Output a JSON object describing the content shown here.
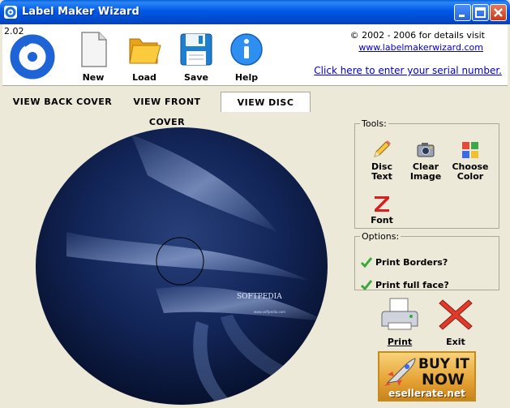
{
  "window": {
    "title": "Label Maker Wizard"
  },
  "header": {
    "version": "2.02",
    "tools": [
      {
        "label": "New"
      },
      {
        "label": "Load"
      },
      {
        "label": "Save"
      },
      {
        "label": "Help"
      }
    ],
    "copyright": "© 2002 - 2006 for details visit",
    "website": "www.labelmakerwizard.com",
    "serial_link": "Click here to enter your serial number."
  },
  "tabs": [
    {
      "label": "VIEW BACK COVER",
      "active": false
    },
    {
      "label": "VIEW FRONT COVER",
      "active": false
    },
    {
      "label": "VIEW DISC",
      "active": true
    }
  ],
  "disc": {
    "brand_text": "SOFTPEDIA",
    "sub_text": "www.softpedia.com"
  },
  "tools_panel": {
    "legend": "Tools:",
    "disc_text": [
      "Disc",
      "Text"
    ],
    "clear_image": [
      "Clear",
      "Image"
    ],
    "choose_color": [
      "Choose",
      "Color"
    ],
    "font": "Font"
  },
  "options_panel": {
    "legend": "Options:",
    "print_borders": "Print Borders?",
    "print_full_face": "Print full face?"
  },
  "actions": {
    "print": "Print",
    "exit": "Exit"
  },
  "buy": {
    "line1": "BUY IT",
    "line2": "NOW",
    "site": "esellerate.net"
  },
  "colors": {
    "titlebar": "#0058e6",
    "disc_dark": "#0b1a3f",
    "link": "#0000cc"
  }
}
